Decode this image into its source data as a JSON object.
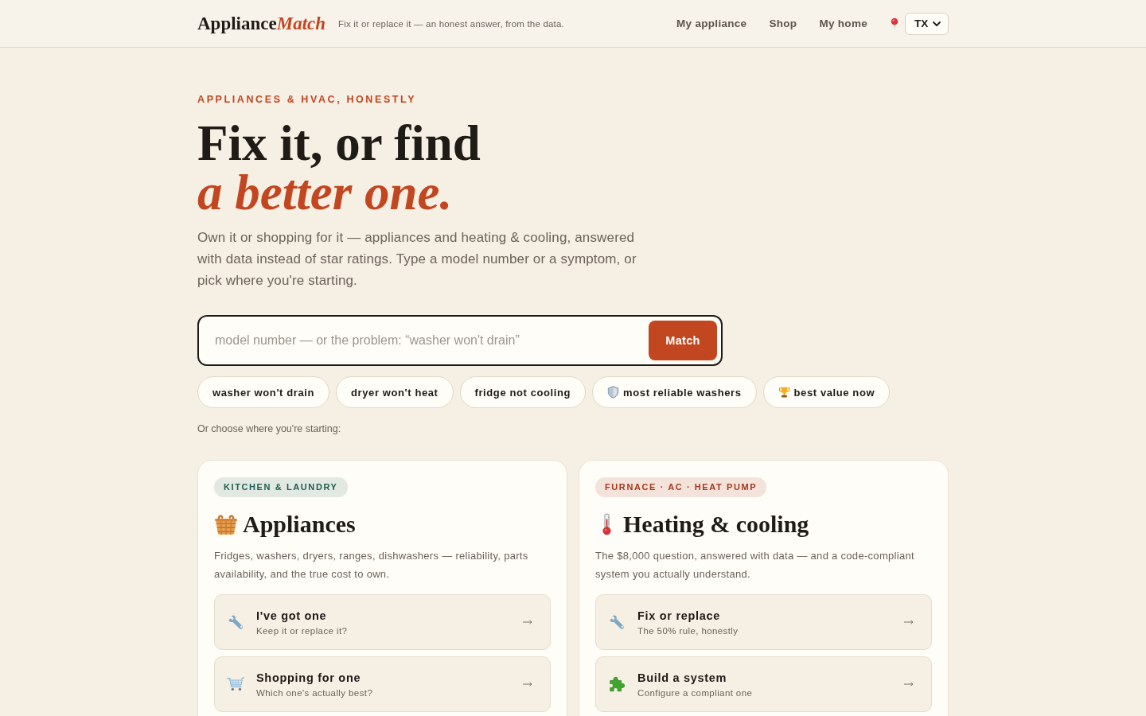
{
  "header": {
    "logo": {
      "main": "Appliance",
      "accent": "Match"
    },
    "tagline": "Fix it or replace it — an honest answer, from the data.",
    "nav": [
      {
        "label": "My appliance"
      },
      {
        "label": "Shop"
      },
      {
        "label": "My home"
      }
    ],
    "region_select": {
      "value": "TX"
    }
  },
  "hero": {
    "eyebrow": "APPLIANCES & HVAC, HONESTLY",
    "title_line_1": "Fix it, or find",
    "title_line_2": "a better one.",
    "intro": "Own it or shopping for it — appliances and heating & cooling, answered with data instead of star ratings. Type a model number or a symptom, or pick where you're starting."
  },
  "search": {
    "placeholder": "model number — or the problem: “washer won't drain”",
    "button": "Match"
  },
  "suggestions": [
    "washer won't drain",
    "dryer won't heat",
    "fridge not cooling",
    "most reliable washers",
    "best value now"
  ],
  "choose_prompt": "Or choose where you're starting:",
  "cards": [
    {
      "tag": "KITCHEN & LAUNDRY",
      "color": "#1d5e52",
      "title": "Appliances",
      "description": "Fridges, washers, dryers, ranges, dishwashers — reliability, parts availability, and the true cost to own.",
      "options": [
        {
          "title": "I've got one",
          "subtitle": "Keep it or replace it?"
        },
        {
          "title": "Shopping for one",
          "subtitle": "Which one's actually best?"
        }
      ]
    },
    {
      "tag": "FURNACE · AC · HEAT PUMP",
      "color": "#a8371a",
      "title": "Heating & cooling",
      "description": "The $8,000 question, answered with data — and a code-compliant system you actually understand.",
      "options": [
        {
          "title": "Fix or replace",
          "subtitle": "The 50% rule, honestly"
        },
        {
          "title": "Build a system",
          "subtitle": "Configure a compliant one"
        }
      ]
    }
  ]
}
